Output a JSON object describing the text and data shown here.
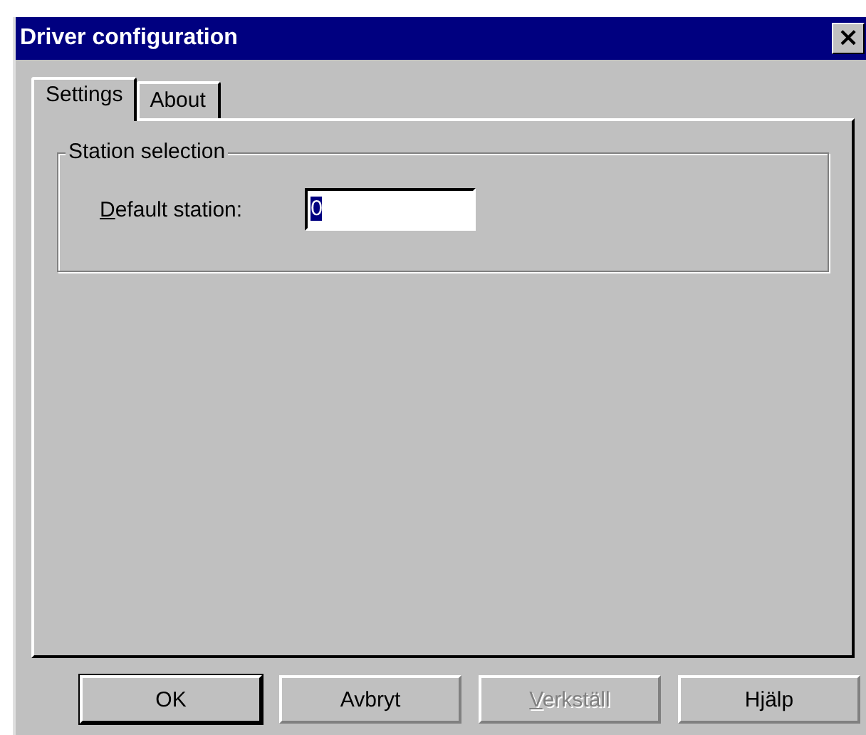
{
  "window": {
    "title": "Driver configuration",
    "close": "×"
  },
  "tabs": [
    {
      "label": "Settings",
      "selected": true
    },
    {
      "label": "About",
      "selected": false
    }
  ],
  "group": {
    "title": "Station selection",
    "field": {
      "label": "Default station:",
      "label_key_underlined": true,
      "value": "0",
      "value_selected": true
    }
  },
  "buttons": [
    {
      "label": "OK",
      "default": true,
      "disabled": false,
      "key_underlined": false
    },
    {
      "label": "Avbryt",
      "default": false,
      "disabled": false,
      "key_underlined": false
    },
    {
      "label": "Verkställ",
      "default": false,
      "disabled": true,
      "key_underlined": true
    },
    {
      "label": "Hjälp",
      "default": false,
      "disabled": false,
      "key_underlined": false
    }
  ]
}
